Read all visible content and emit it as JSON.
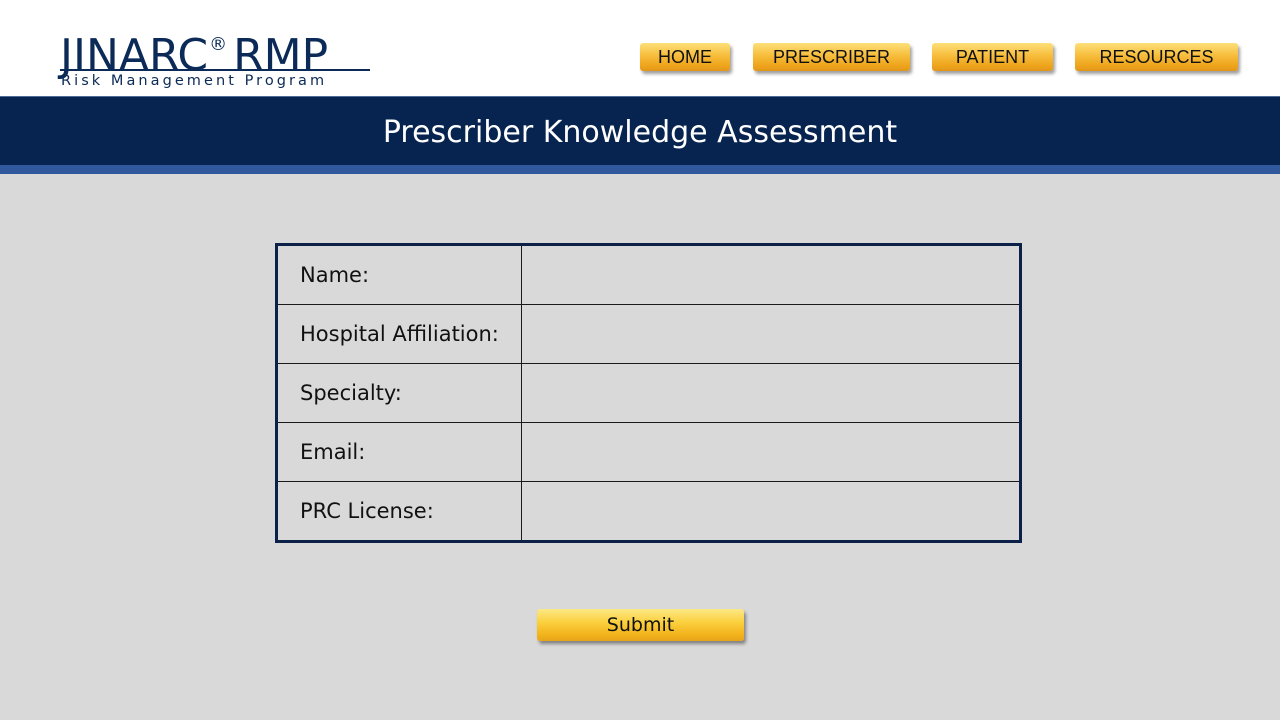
{
  "logo": {
    "brand": "JINARC",
    "registered_mark": "®",
    "program": "RMP",
    "subtitle": "Risk Management Program",
    "color": "#0b2a57"
  },
  "nav": {
    "items": [
      {
        "label": "HOME"
      },
      {
        "label": "PRESCRIBER"
      },
      {
        "label": "PATIENT"
      },
      {
        "label": "RESOURCES"
      }
    ],
    "button_color": "#f7bd3c"
  },
  "banner": {
    "title": "Prescriber Knowledge Assessment",
    "background": "#06244f",
    "stripe_color": "#30599d"
  },
  "form": {
    "fields": [
      {
        "label": "Name:",
        "value": ""
      },
      {
        "label": "Hospital Affiliation:",
        "value": ""
      },
      {
        "label": "Specialty:",
        "value": ""
      },
      {
        "label": "Email:",
        "value": ""
      },
      {
        "label": "PRC License:",
        "value": ""
      }
    ],
    "submit_label": "Submit"
  },
  "page": {
    "background": "#d9d9d9"
  }
}
